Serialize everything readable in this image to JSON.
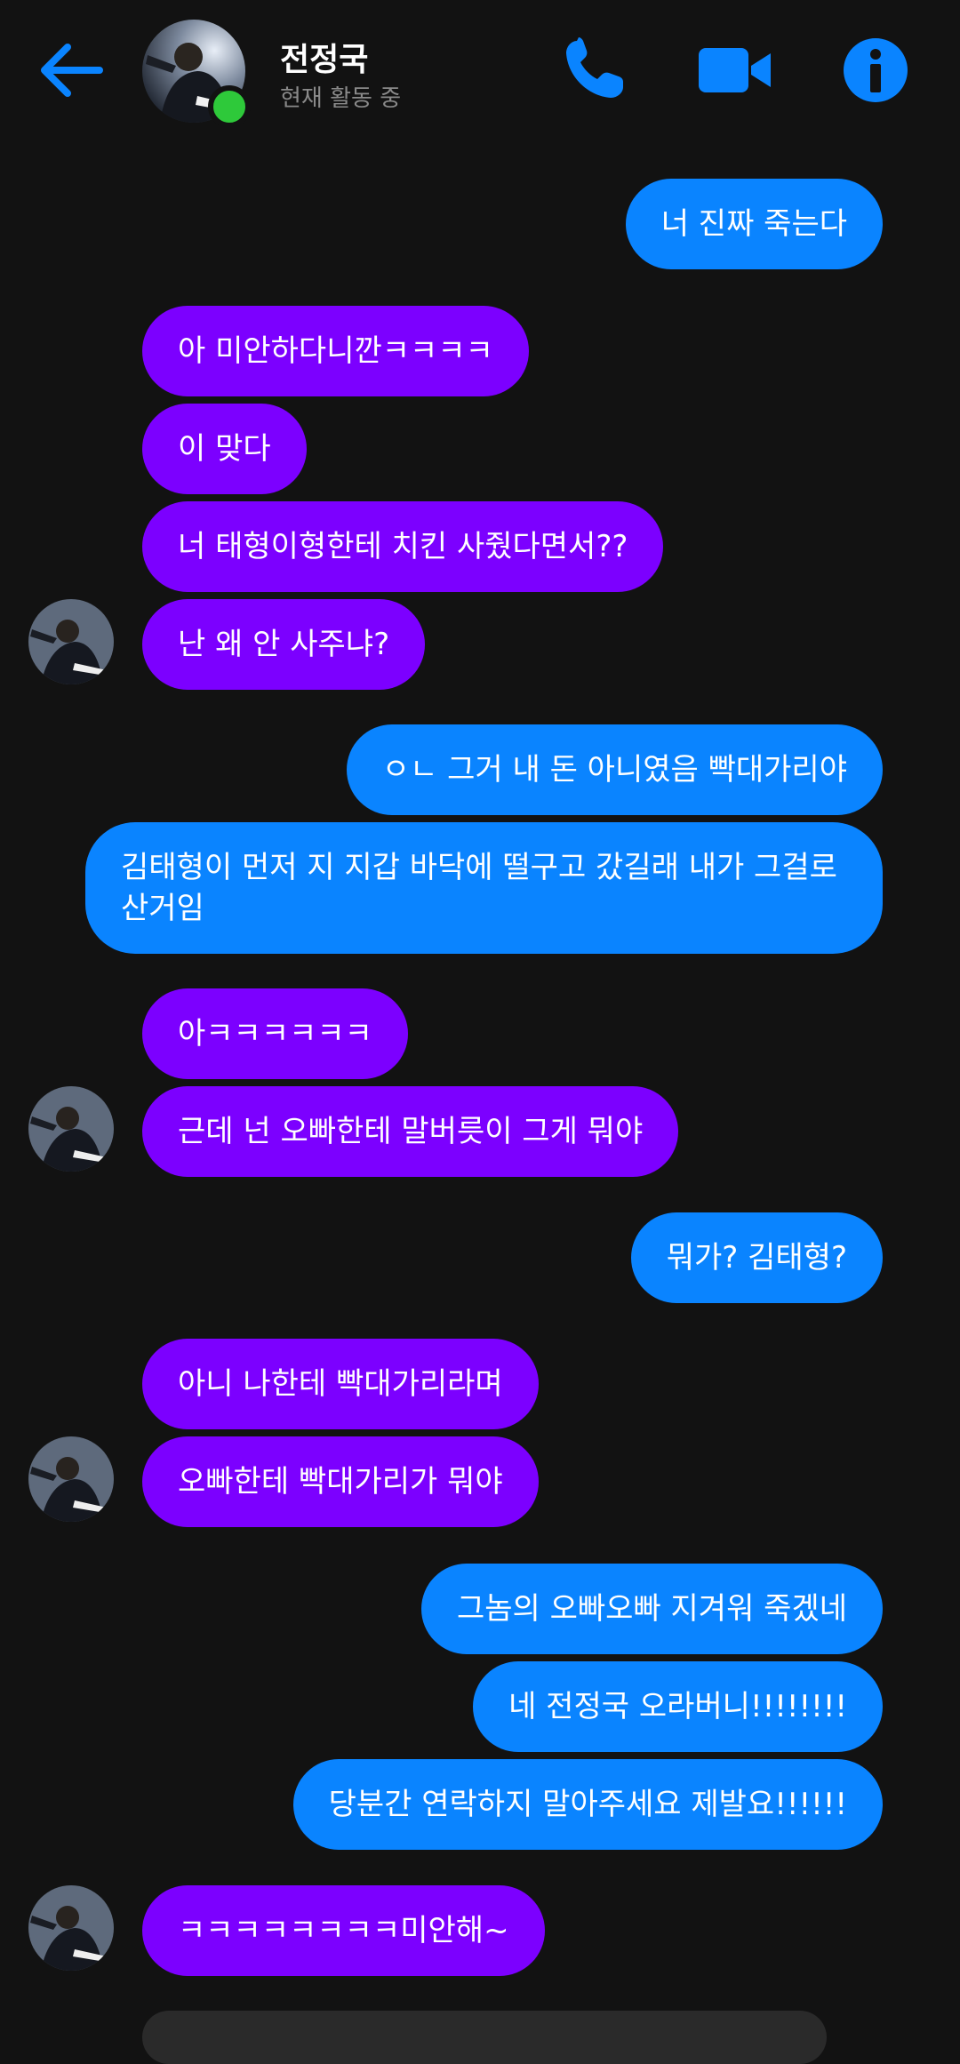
{
  "header": {
    "contact_name": "전정국",
    "status": "현재 활동 중",
    "accent_color": "#0a84ff",
    "online_color": "#2ec93a",
    "icons": [
      "back-arrow-icon",
      "phone-icon",
      "video-camera-icon",
      "info-icon"
    ]
  },
  "colors": {
    "incoming_bubble": "#7c00ff",
    "outgoing_bubble": "#0a84ff",
    "background": "#121212"
  },
  "messages": [
    {
      "side": "out",
      "text": "너 진짜 죽는다"
    },
    {
      "side": "in",
      "text": "아 미안하다니깐ㅋㅋㅋㅋ"
    },
    {
      "side": "in",
      "text": "이 맞다"
    },
    {
      "side": "in",
      "text": "너 태형이형한테 치킨 사줬다면서??"
    },
    {
      "side": "in",
      "text": "난 왜 안 사주냐?"
    },
    {
      "side": "out",
      "text": "ㅇㄴ 그거 내 돈 아니였음 빡대가리야"
    },
    {
      "side": "out",
      "text": "김태형이 먼저 지 지갑 바닥에 떨구고 갔길래 내가 그걸로 산거임"
    },
    {
      "side": "in",
      "text": "아ㅋㅋㅋㅋㅋㅋ"
    },
    {
      "side": "in",
      "text": "근데 넌 오빠한테 말버릇이 그게 뭐야"
    },
    {
      "side": "out",
      "text": "뭐가? 김태형?"
    },
    {
      "side": "in",
      "text": "아니 나한테 빡대가리라며"
    },
    {
      "side": "in",
      "text": "오빠한테 빡대가리가 뭐야"
    },
    {
      "side": "out",
      "text": "그놈의 오빠오빠 지겨워 죽겠네"
    },
    {
      "side": "out",
      "text": "네 전정국 오라버니!!!!!!!!"
    },
    {
      "side": "out",
      "text": "당분간 연락하지 말아주세요 제발요!!!!!!"
    },
    {
      "side": "in",
      "text": "ㅋㅋㅋㅋㅋㅋㅋㅋ미안해~"
    }
  ]
}
